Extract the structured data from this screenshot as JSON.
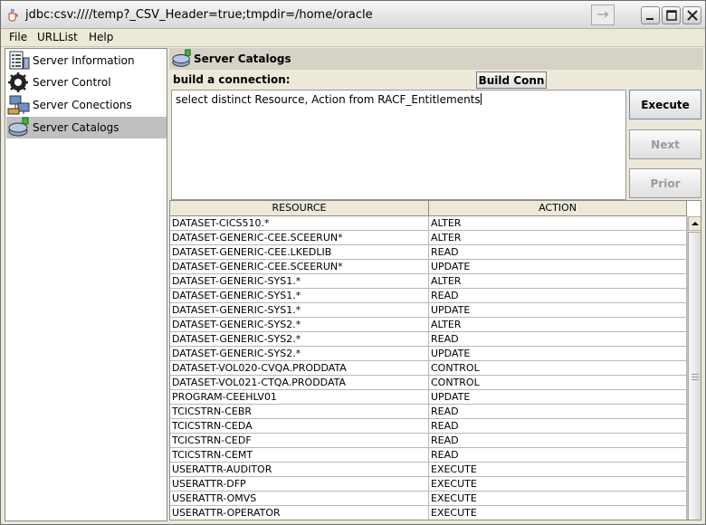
{
  "window": {
    "title": "jdbc:csv:////temp?_CSV_Header=true;tmpdir=/home/oracle",
    "icon": "java-cup-icon"
  },
  "menu": [
    "File",
    "URLList",
    "Help"
  ],
  "sidebar": {
    "items": [
      {
        "label": "Server Information",
        "icon": "server-info-icon",
        "selected": false
      },
      {
        "label": "Server Control",
        "icon": "server-control-icon",
        "selected": false
      },
      {
        "label": "Server Conections",
        "icon": "server-connections-icon",
        "selected": false
      },
      {
        "label": "Server Catalogs",
        "icon": "server-catalogs-icon",
        "selected": true
      }
    ]
  },
  "main": {
    "header": "Server Catalogs",
    "connection_label": "build a connection:",
    "build_button": "Build Conn",
    "query": "select distinct Resource, Action from RACF_Entitlements",
    "buttons": {
      "execute": "Execute",
      "next": "Next",
      "prior": "Prior"
    },
    "table": {
      "columns": [
        "RESOURCE",
        "ACTION"
      ],
      "rows": [
        [
          "DATASET-CICS510.*",
          "ALTER"
        ],
        [
          "DATASET-GENERIC-CEE.SCEERUN*",
          "ALTER"
        ],
        [
          "DATASET-GENERIC-CEE.LKEDLIB",
          "READ"
        ],
        [
          "DATASET-GENERIC-CEE.SCEERUN*",
          "UPDATE"
        ],
        [
          "DATASET-GENERIC-SYS1.*",
          "ALTER"
        ],
        [
          "DATASET-GENERIC-SYS1.*",
          "READ"
        ],
        [
          "DATASET-GENERIC-SYS1.*",
          "UPDATE"
        ],
        [
          "DATASET-GENERIC-SYS2.*",
          "ALTER"
        ],
        [
          "DATASET-GENERIC-SYS2.*",
          "READ"
        ],
        [
          "DATASET-GENERIC-SYS2.*",
          "UPDATE"
        ],
        [
          "DATASET-VOL020-CVQA.PRODDATA",
          "CONTROL"
        ],
        [
          "DATASET-VOL021-CTQA.PRODDATA",
          "CONTROL"
        ],
        [
          "PROGRAM-CEEHLV01",
          "UPDATE"
        ],
        [
          "TCICSTRN-CEBR",
          "READ"
        ],
        [
          "TCICSTRN-CEDA",
          "READ"
        ],
        [
          "TCICSTRN-CEDF",
          "READ"
        ],
        [
          "TCICSTRN-CEMT",
          "READ"
        ],
        [
          "USERATTR-AUDITOR",
          "EXECUTE"
        ],
        [
          "USERATTR-DFP",
          "EXECUTE"
        ],
        [
          "USERATTR-OMVS",
          "EXECUTE"
        ],
        [
          "USERATTR-OPERATOR",
          "EXECUTE"
        ]
      ]
    }
  }
}
